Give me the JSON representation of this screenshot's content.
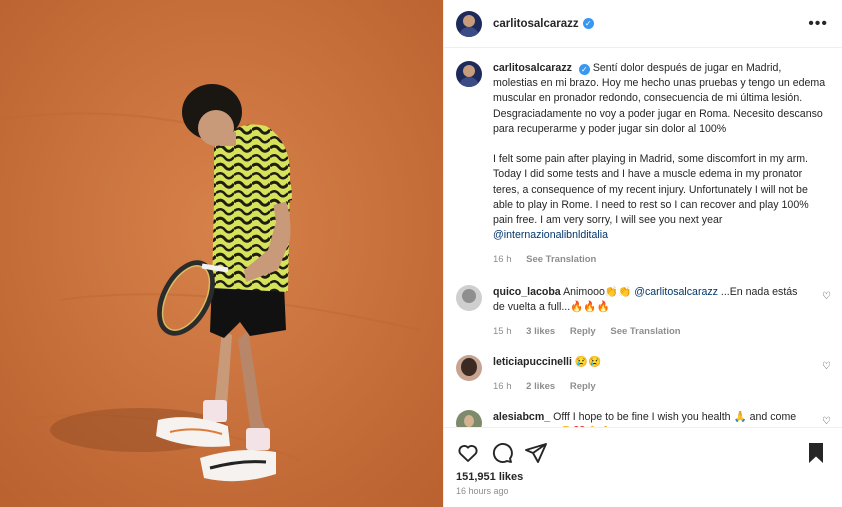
{
  "post": {
    "username": "carlitosalcarazz",
    "verified_icon": "verified-badge-icon",
    "more_icon": "more-options-icon"
  },
  "caption": {
    "username": "carlitosalcarazz",
    "text_es": "Sentí dolor después de jugar en Madrid, molestias en mi brazo. Hoy me hecho unas pruebas y tengo un edema muscular en pronador redondo, consecuencia de mi última lesión. Desgraciadamente no voy a poder jugar en Roma. Necesito descanso para recuperarme y poder jugar sin dolor al 100%",
    "text_en": "I felt some pain after playing in Madrid, some discomfort in my arm. Today I did some tests and I have a muscle edema in my pronator teres, a consequence of my recent injury. Unfortunately I will not be able to play in Rome. I need to rest so I can recover and play 100% pain free. I am very sorry, I will see you next year",
    "mention": "@internazionalibnlditalia",
    "time": "16 h",
    "see_translation": "See Translation"
  },
  "comments": [
    {
      "username": "quico_lacoba",
      "text_start": "Animooo👏👏 ",
      "mention": "@carlitosalcarazz",
      "text_end": " ...En nada estás de vuelta a full...🔥🔥🔥",
      "time": "15 h",
      "likes": "3 likes",
      "reply": "Reply",
      "see_translation": "See Translation"
    },
    {
      "username": "leticiapuccinelli",
      "text": "😢😢",
      "time": "16 h",
      "likes": "2 likes",
      "reply": "Reply"
    },
    {
      "username": "alesiabcm_",
      "text": "Offf I hope to be fine I wish you health 🙏 and come back like now 😢❤️💪🙏"
    }
  ],
  "actions": {
    "likes": "151,951 likes",
    "time_ago": "16 hours ago"
  },
  "colors": {
    "clay": "#c9713a",
    "shirt_yellow": "#d6e35a",
    "text": "#262626",
    "secondary": "#8e8e8e",
    "verified": "#3897f0",
    "mention": "#00376b"
  }
}
